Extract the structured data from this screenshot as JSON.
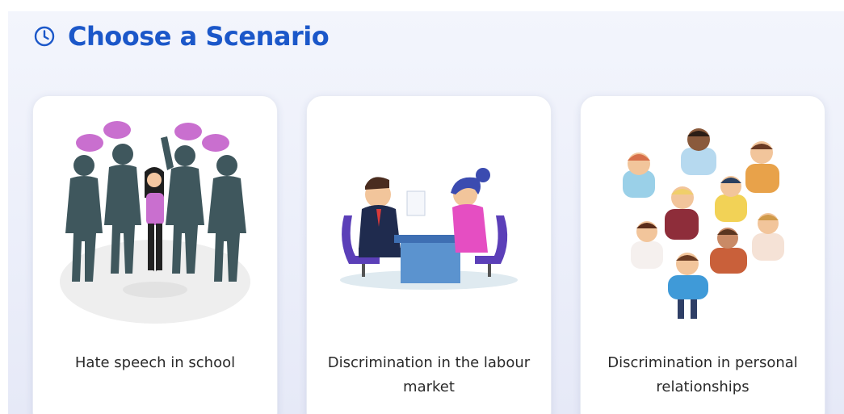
{
  "header": {
    "title": "Choose a Scenario",
    "icon": "clock-icon",
    "accent_color": "#1b57c9"
  },
  "scenarios": [
    {
      "label": "Hate speech in school",
      "illustration": "bullying-crowd-illustration"
    },
    {
      "label": "Discrimination in the labour market",
      "illustration": "job-interview-illustration"
    },
    {
      "label": "Discrimination in personal relationships",
      "illustration": "diverse-people-group-illustration"
    }
  ]
}
